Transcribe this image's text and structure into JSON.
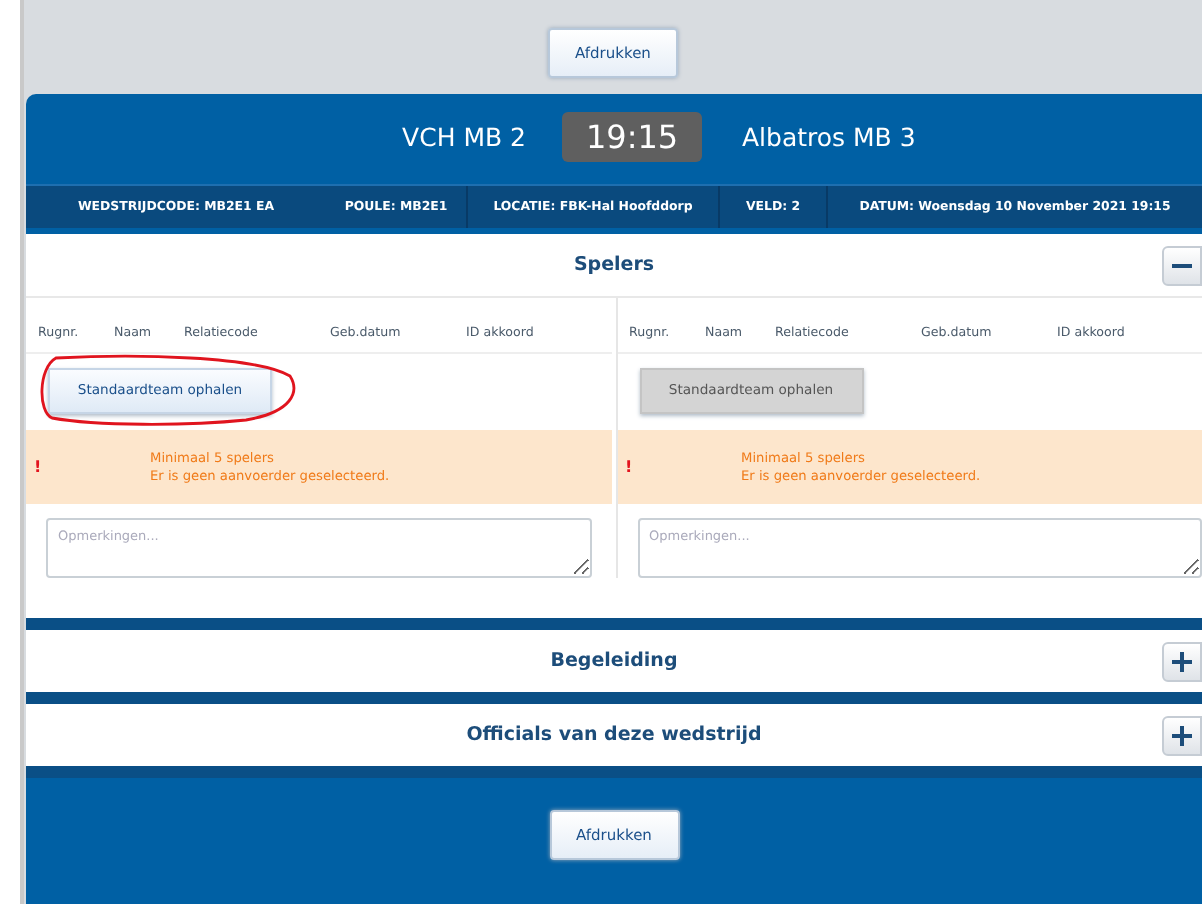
{
  "top_button": "Afdrukken",
  "match": {
    "home": "VCH MB 2",
    "time": "19:15",
    "away": "Albatros MB 3"
  },
  "info": [
    "WEDSTRIJDCODE: MB2E1 EA",
    "POULE: MB2E1",
    "LOCATIE: FBK-Hal Hoofddorp",
    "VELD: 2",
    "DATUM: Woensdag 10 November 2021 19:15"
  ],
  "sections": [
    {
      "title": "Spelers",
      "expanded": true,
      "teams": [
        {
          "columns": [
            "Rugnr.",
            "Naam",
            "Relatiecode",
            "Geb.datum",
            "ID akkoord"
          ],
          "button": {
            "label": "Standaardteam ophalen",
            "disabled": false,
            "highlighted": true
          },
          "warning_icon": "!",
          "warnings": [
            "Minimaal 5 spelers",
            "Er is geen aanvoerder geselecteerd."
          ],
          "remarks_placeholder": "Opmerkingen..."
        },
        {
          "columns": [
            "Rugnr.",
            "Naam",
            "Relatiecode",
            "Geb.datum",
            "ID akkoord"
          ],
          "button": {
            "label": "Standaardteam ophalen",
            "disabled": true,
            "highlighted": false
          },
          "warning_icon": "!",
          "warnings": [
            "Minimaal 5 spelers",
            "Er is geen aanvoerder geselecteerd."
          ],
          "remarks_placeholder": "Opmerkingen..."
        }
      ]
    },
    {
      "title": "Begeleiding",
      "expanded": false
    },
    {
      "title": "Officials van deze wedstrijd",
      "expanded": false
    }
  ],
  "bottom_button": "Afdrukken"
}
